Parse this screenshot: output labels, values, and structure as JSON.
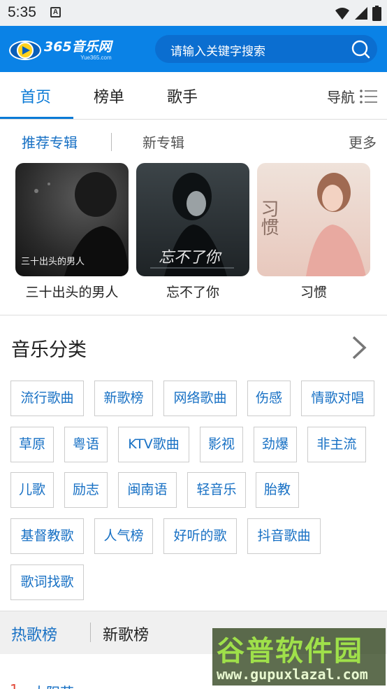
{
  "status_bar": {
    "time": "5:35",
    "notification_badge": "A"
  },
  "header": {
    "logo_main": "365音乐网",
    "logo_sub": "Yue365.com",
    "search_placeholder": "请输入关键字搜索",
    "colors": {
      "bar": "#0a82e6",
      "search_bg": "#0b6ed0"
    }
  },
  "tabs": [
    {
      "label": "首页",
      "active": true
    },
    {
      "label": "榜单",
      "active": false
    },
    {
      "label": "歌手",
      "active": false
    }
  ],
  "nav_label": "导航",
  "albums_section": {
    "tab_recommended": "推荐专辑",
    "tab_new": "新专辑",
    "more": "更多",
    "albums": [
      {
        "name": "三十出头的男人",
        "cover_text": "三十出头的男人"
      },
      {
        "name": "忘不了你",
        "cover_text": "忘不了你"
      },
      {
        "name": "习惯",
        "cover_text": "习惯"
      }
    ]
  },
  "categories": {
    "title": "音乐分类",
    "items": [
      "流行歌曲",
      "新歌榜",
      "网络歌曲",
      "伤感",
      "情歌对唱",
      "草原",
      "粤语",
      "KTV歌曲",
      "影视",
      "劲爆",
      "非主流",
      "儿歌",
      "励志",
      "闽南语",
      "轻音乐",
      "胎教",
      "基督教歌",
      "人气榜",
      "好听的歌",
      "抖音歌曲",
      "歌词找歌"
    ]
  },
  "charts": {
    "tab_hot": "热歌榜",
    "tab_new": "新歌榜",
    "first_row": {
      "rank": "1",
      "title": "大阳花"
    }
  },
  "watermark": {
    "cn": "谷普软件园",
    "en": "www.gupuxlazal.com"
  },
  "accent_color": "#0a7ad6"
}
